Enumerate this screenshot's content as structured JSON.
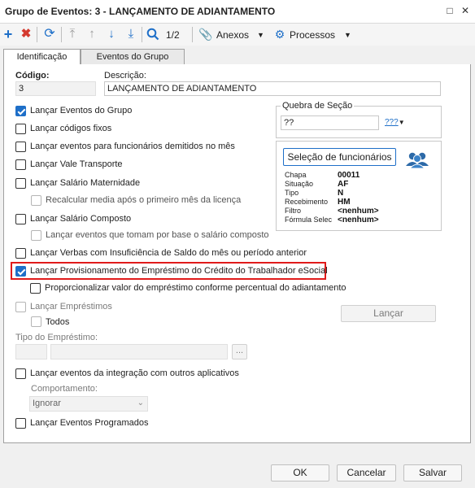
{
  "window": {
    "title": "Grupo de Eventos: 3 - LANÇAMENTO DE ADIANTAMENTO"
  },
  "toolbar": {
    "page": "1/2",
    "anexos": "Anexos",
    "processos": "Processos"
  },
  "tabs": [
    {
      "label": "Identificação"
    },
    {
      "label": "Eventos do Grupo"
    }
  ],
  "form": {
    "codigo_label": "Código:",
    "codigo_value": "3",
    "descricao_label": "Descrição:",
    "descricao_value": "LANÇAMENTO DE ADIANTAMENTO",
    "quebra_label": "Quebra de Seção",
    "quebra_value": "??",
    "quebra_button": "???",
    "selecao_button": "Seleção de funcionários"
  },
  "info": {
    "labels": [
      "Chapa",
      "Situação",
      "Tipo",
      "Recebimento",
      "Filtro",
      "Fórmula Selec"
    ],
    "values": [
      "00011",
      "AF",
      "N",
      "HM",
      "<nenhum>",
      "<nenhum>"
    ]
  },
  "checkboxes": {
    "c1": "Lançar Eventos do Grupo",
    "c2": "Lançar códigos fixos",
    "c3": "Lançar eventos para funcionários demitidos no mês",
    "c4": "Lançar Vale Transporte",
    "c5": "Lançar Salário Maternidade",
    "c6": "Recalcular media após o primeiro mês da licença",
    "c7": "Lançar Salário Composto",
    "c8": "Lançar eventos que tomam por base o salário composto",
    "c9": "Lançar Verbas com Insuficiência de Saldo do mês ou período anterior",
    "c10": "Lançar Provisionamento do Empréstimo do Crédito do Trabalhador eSocial",
    "c11": "Proporcionalizar valor do empréstimo conforme percentual do adiantamento",
    "c12": "Lançar Empréstimos",
    "c13": "Todos",
    "c14": "Lançar eventos da integração com outros aplicativos",
    "c15": "Lançar Eventos Programados"
  },
  "lancar_button": "Lançar",
  "tipo_emprestimo_label": "Tipo do Empréstimo:",
  "ellipsis": "...",
  "comportamento_label": "Comportamento:",
  "comportamento_value": "Ignorar",
  "footer": {
    "ok": "OK",
    "cancel": "Cancelar",
    "save": "Salvar"
  },
  "colors": {
    "accent": "#1e6fc8",
    "highlight": "#e01b1b",
    "add": "#1e6fc8",
    "delete": "#d43a2f"
  }
}
